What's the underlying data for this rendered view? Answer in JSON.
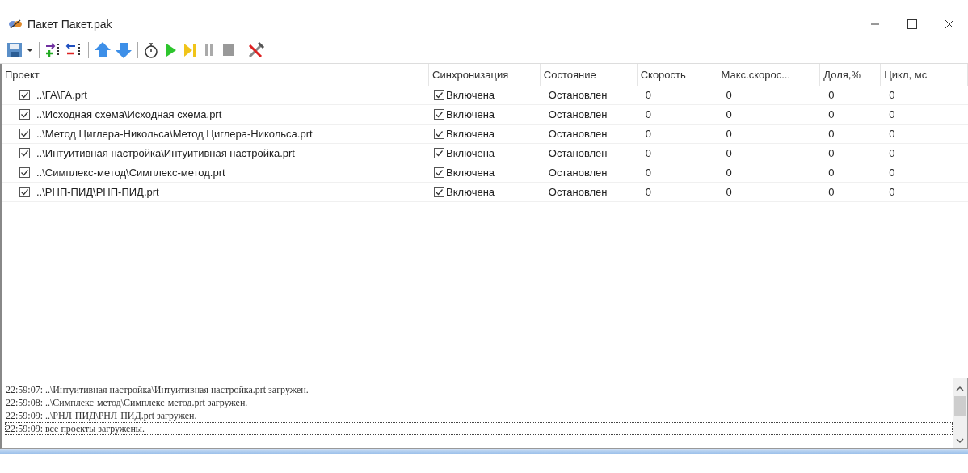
{
  "window": {
    "title": "Пакет  Пакет.pak"
  },
  "columns": [
    "Проект",
    "Синхронизация",
    "Состояние",
    "Скорость",
    "Макс.скорос...",
    "Доля,%",
    "Цикл, мс"
  ],
  "rows": [
    {
      "project": "..\\ГА\\ГА.prt",
      "checked": true,
      "sync": "Включена",
      "sync_checked": true,
      "state": "Остановлен",
      "speed": "0",
      "max_speed": "0",
      "share": "0",
      "cycle": "0"
    },
    {
      "project": "..\\Исходная схема\\Исходная схема.prt",
      "checked": true,
      "sync": "Включена",
      "sync_checked": true,
      "state": "Остановлен",
      "speed": "0",
      "max_speed": "0",
      "share": "0",
      "cycle": "0"
    },
    {
      "project": "..\\Метод Циглера-Никольса\\Метод Циглера-Никольса.prt",
      "checked": true,
      "sync": "Включена",
      "sync_checked": true,
      "state": "Остановлен",
      "speed": "0",
      "max_speed": "0",
      "share": "0",
      "cycle": "0"
    },
    {
      "project": "..\\Интуитивная настройка\\Интуитивная настройка.prt",
      "checked": true,
      "sync": "Включена",
      "sync_checked": true,
      "state": "Остановлен",
      "speed": "0",
      "max_speed": "0",
      "share": "0",
      "cycle": "0"
    },
    {
      "project": "..\\Симплекс-метод\\Симплекс-метод.prt",
      "checked": true,
      "sync": "Включена",
      "sync_checked": true,
      "state": "Остановлен",
      "speed": "0",
      "max_speed": "0",
      "share": "0",
      "cycle": "0"
    },
    {
      "project": "..\\РНП-ПИД\\РНП-ПИД.prt",
      "checked": true,
      "sync": "Включена",
      "sync_checked": true,
      "state": "Остановлен",
      "speed": "0",
      "max_speed": "0",
      "share": "0",
      "cycle": "0"
    }
  ],
  "log": [
    {
      "text": "22:59:07: ..\\Интуитивная настройка\\Интуитивная настройка.prt загружен.",
      "selected": false
    },
    {
      "text": "22:59:08: ..\\Симплекс-метод\\Симплекс-метод.prt загружен.",
      "selected": false
    },
    {
      "text": "22:59:09: ..\\РНЛ-ПИД\\РНЛ-ПИД.prt загружен.",
      "selected": false
    },
    {
      "text": "22:59:09:  все проекты загружены.",
      "selected": true
    }
  ]
}
